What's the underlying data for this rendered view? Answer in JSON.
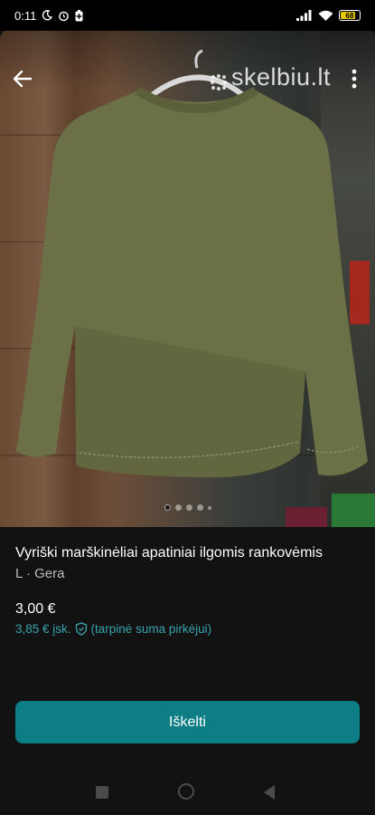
{
  "status_bar": {
    "time": "0:11",
    "battery_level": "68",
    "icons": [
      "moon-icon",
      "alarm-icon",
      "battery-saver-icon",
      "signal-icon",
      "wifi-icon",
      "battery-icon"
    ]
  },
  "gallery": {
    "watermark": "skelbiu.lt",
    "image_count": 5,
    "active_index": 0,
    "back_icon": "arrow-left-icon",
    "more_icon": "more-vertical-icon"
  },
  "listing": {
    "title": "Vyriški marškinėliai apatiniai ilgomis rankovėmis",
    "size_condition": "L · Gera",
    "price": "3,00 €",
    "buyer_price": "3,85 € įsk.",
    "buyer_note": "(tarpinė suma pirkėjui)"
  },
  "actions": {
    "promote_label": "Iškelti"
  },
  "colors": {
    "accent": "#0d7d86",
    "accent_text": "#36a3ad",
    "background": "#121212",
    "shirt": "#6b7046"
  }
}
